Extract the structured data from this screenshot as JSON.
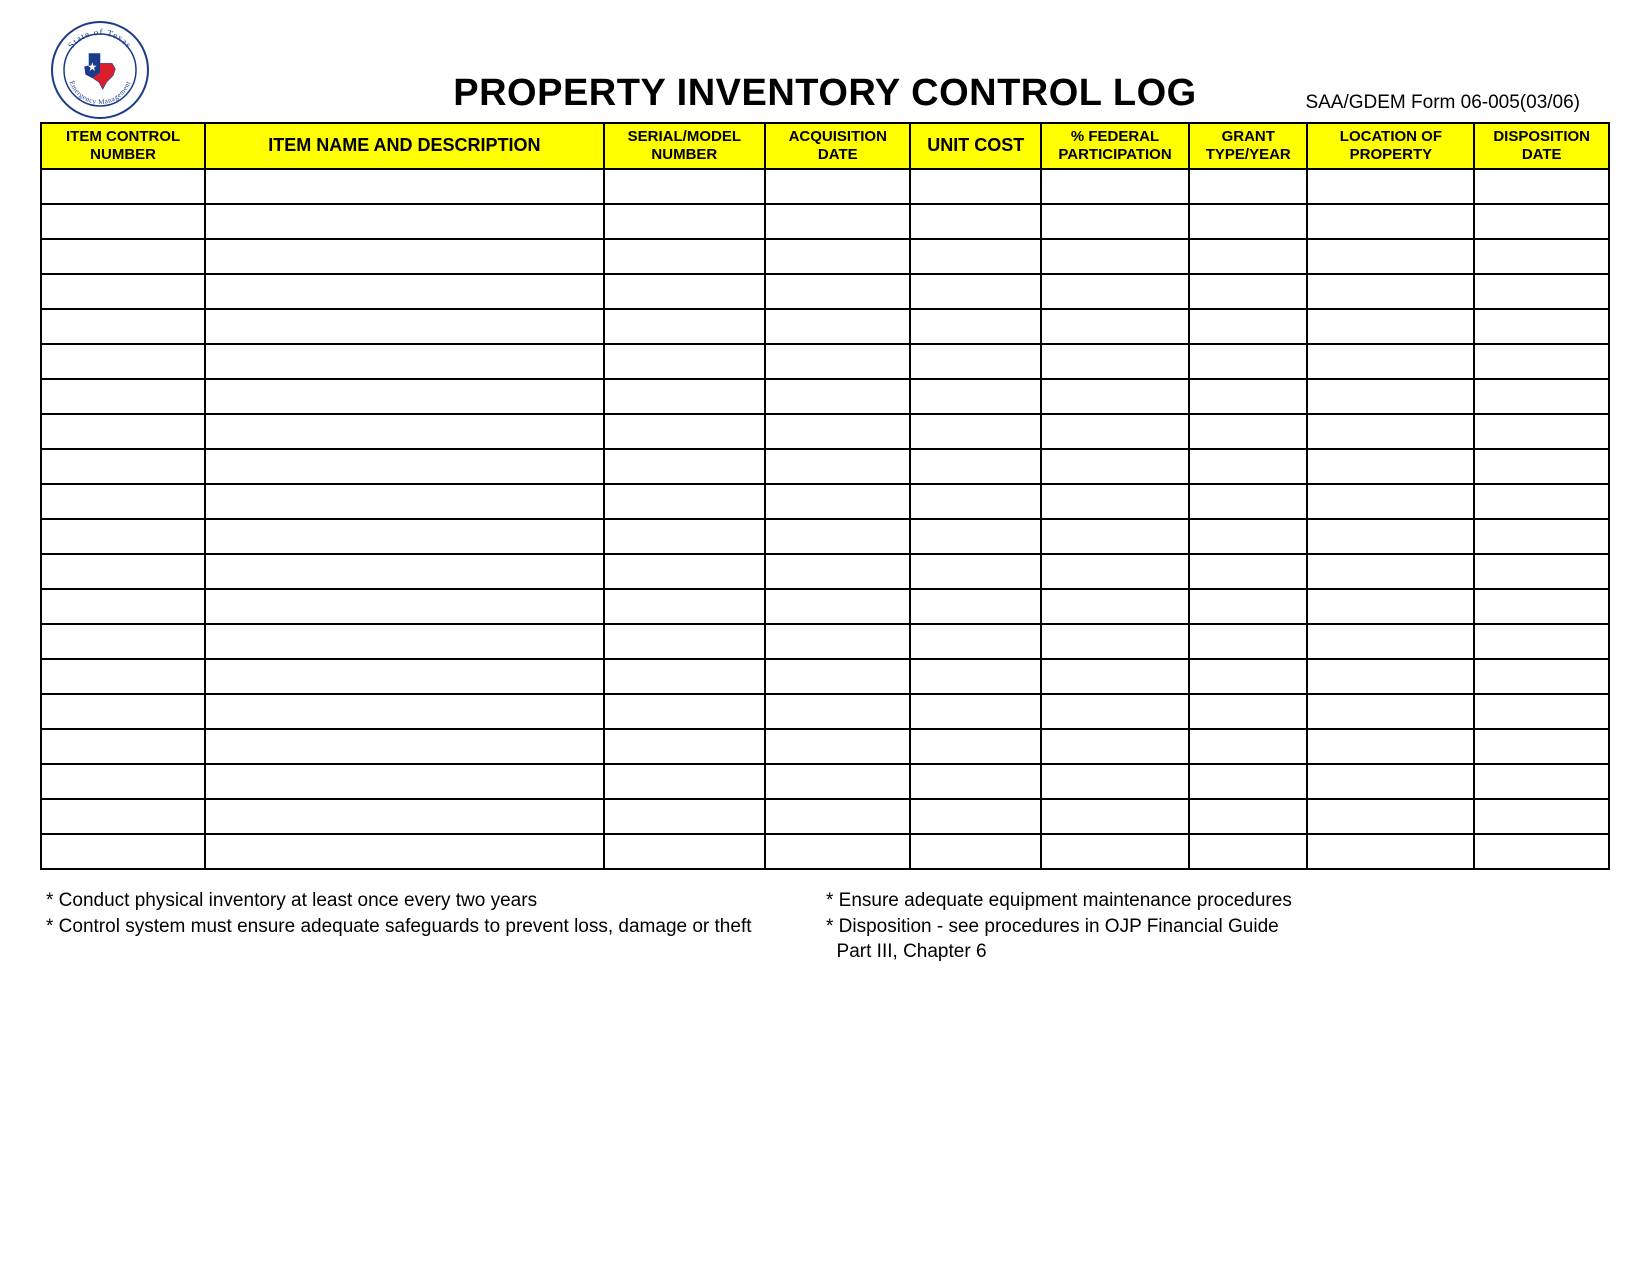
{
  "header": {
    "title": "PROPERTY INVENTORY CONTROL LOG",
    "form_id": "SAA/GDEM Form 06-005(03/06)",
    "seal_top_text": "State of Texas",
    "seal_bottom_text": "Emergency Management"
  },
  "table": {
    "columns": [
      "ITEM CONTROL NUMBER",
      "ITEM NAME AND DESCRIPTION",
      "SERIAL/MODEL NUMBER",
      "ACQUISITION DATE",
      "UNIT COST",
      "% FEDERAL PARTICIPATION",
      "GRANT TYPE/YEAR",
      "LOCATION OF PROPERTY",
      "DISPOSITION DATE"
    ],
    "row_count": 20
  },
  "footer": {
    "left": [
      "* Conduct physical inventory at least once every two years",
      "* Control system must ensure adequate safeguards to prevent loss, damage or theft"
    ],
    "right": [
      "* Ensure adequate equipment maintenance procedures",
      "* Disposition - see procedures in OJP Financial Guide",
      "  Part III, Chapter 6"
    ]
  }
}
